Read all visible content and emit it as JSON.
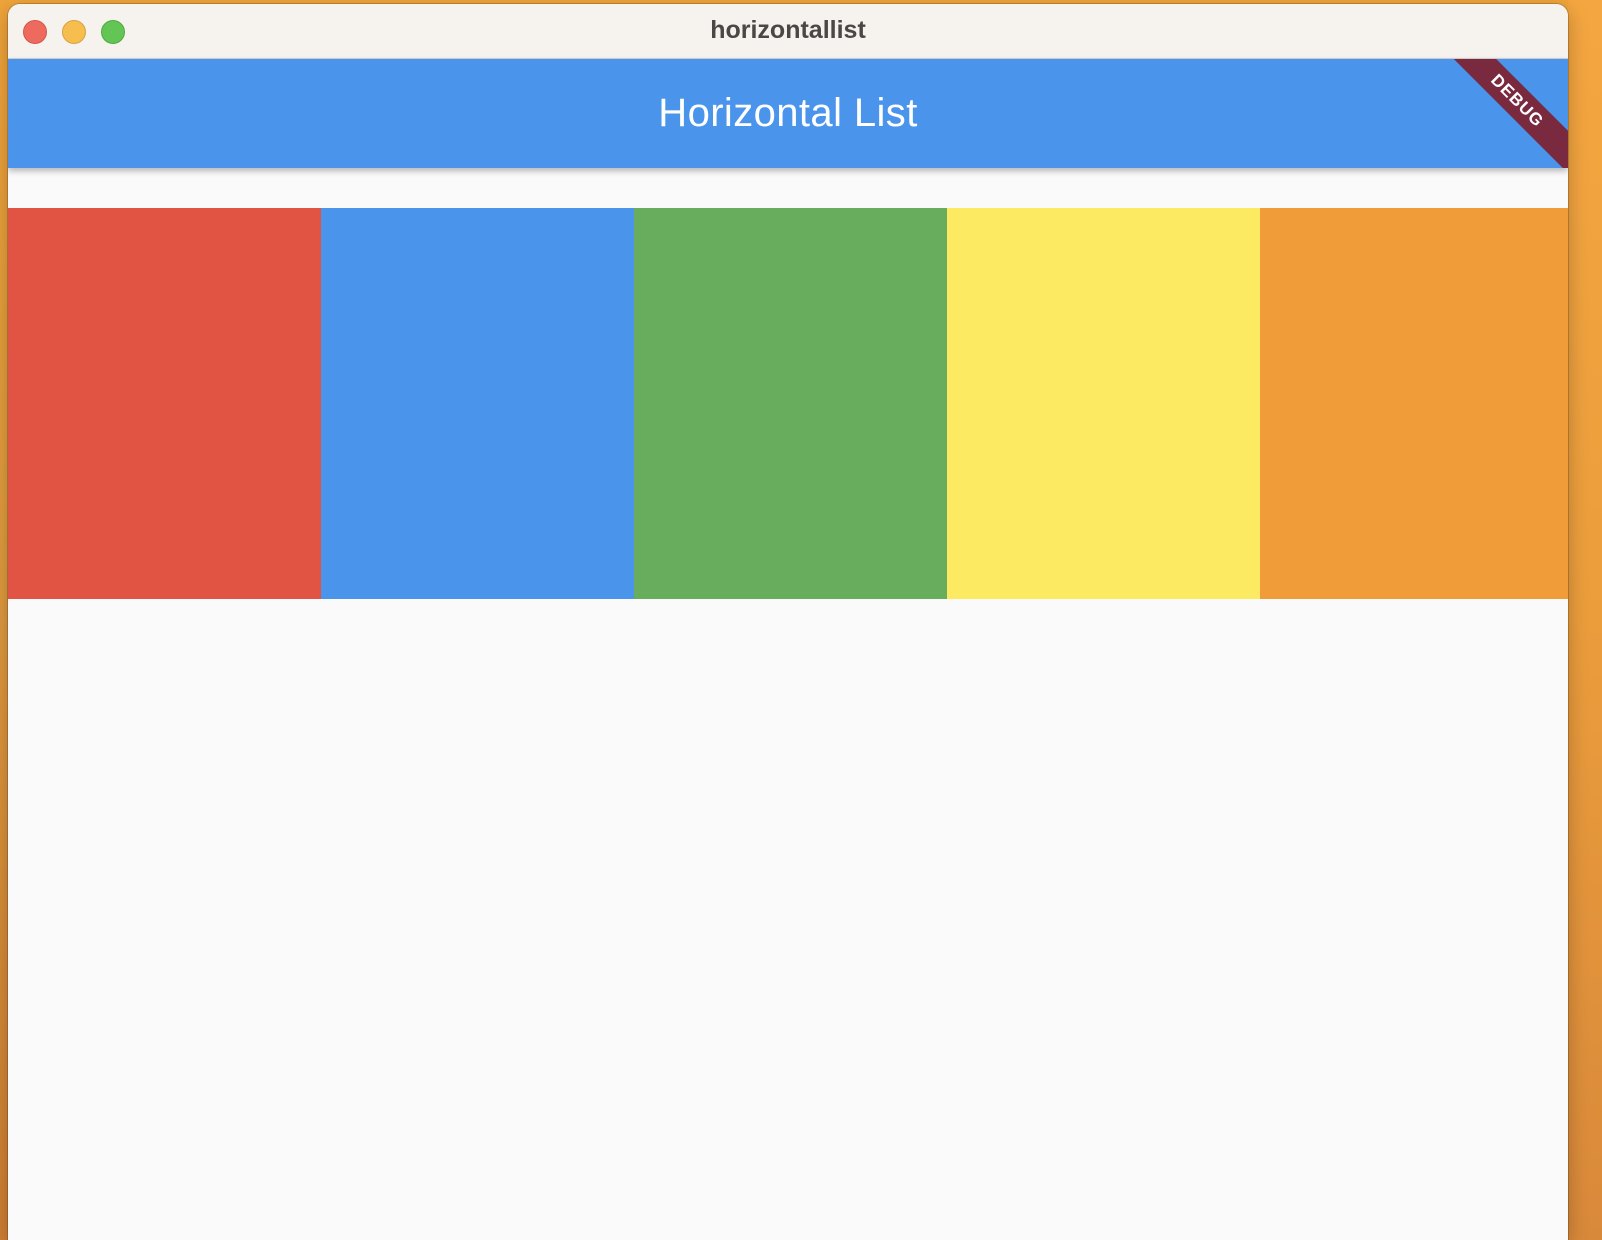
{
  "window": {
    "title": "horizontallist"
  },
  "appbar": {
    "title": "Horizontal List",
    "color": "#4a94ec",
    "debug_label": "DEBUG"
  },
  "list": {
    "items": [
      {
        "color": "#e15342"
      },
      {
        "color": "#4a94ec"
      },
      {
        "color": "#68ac5d"
      },
      {
        "color": "#fdea63"
      },
      {
        "color": "#f09c38"
      }
    ]
  }
}
